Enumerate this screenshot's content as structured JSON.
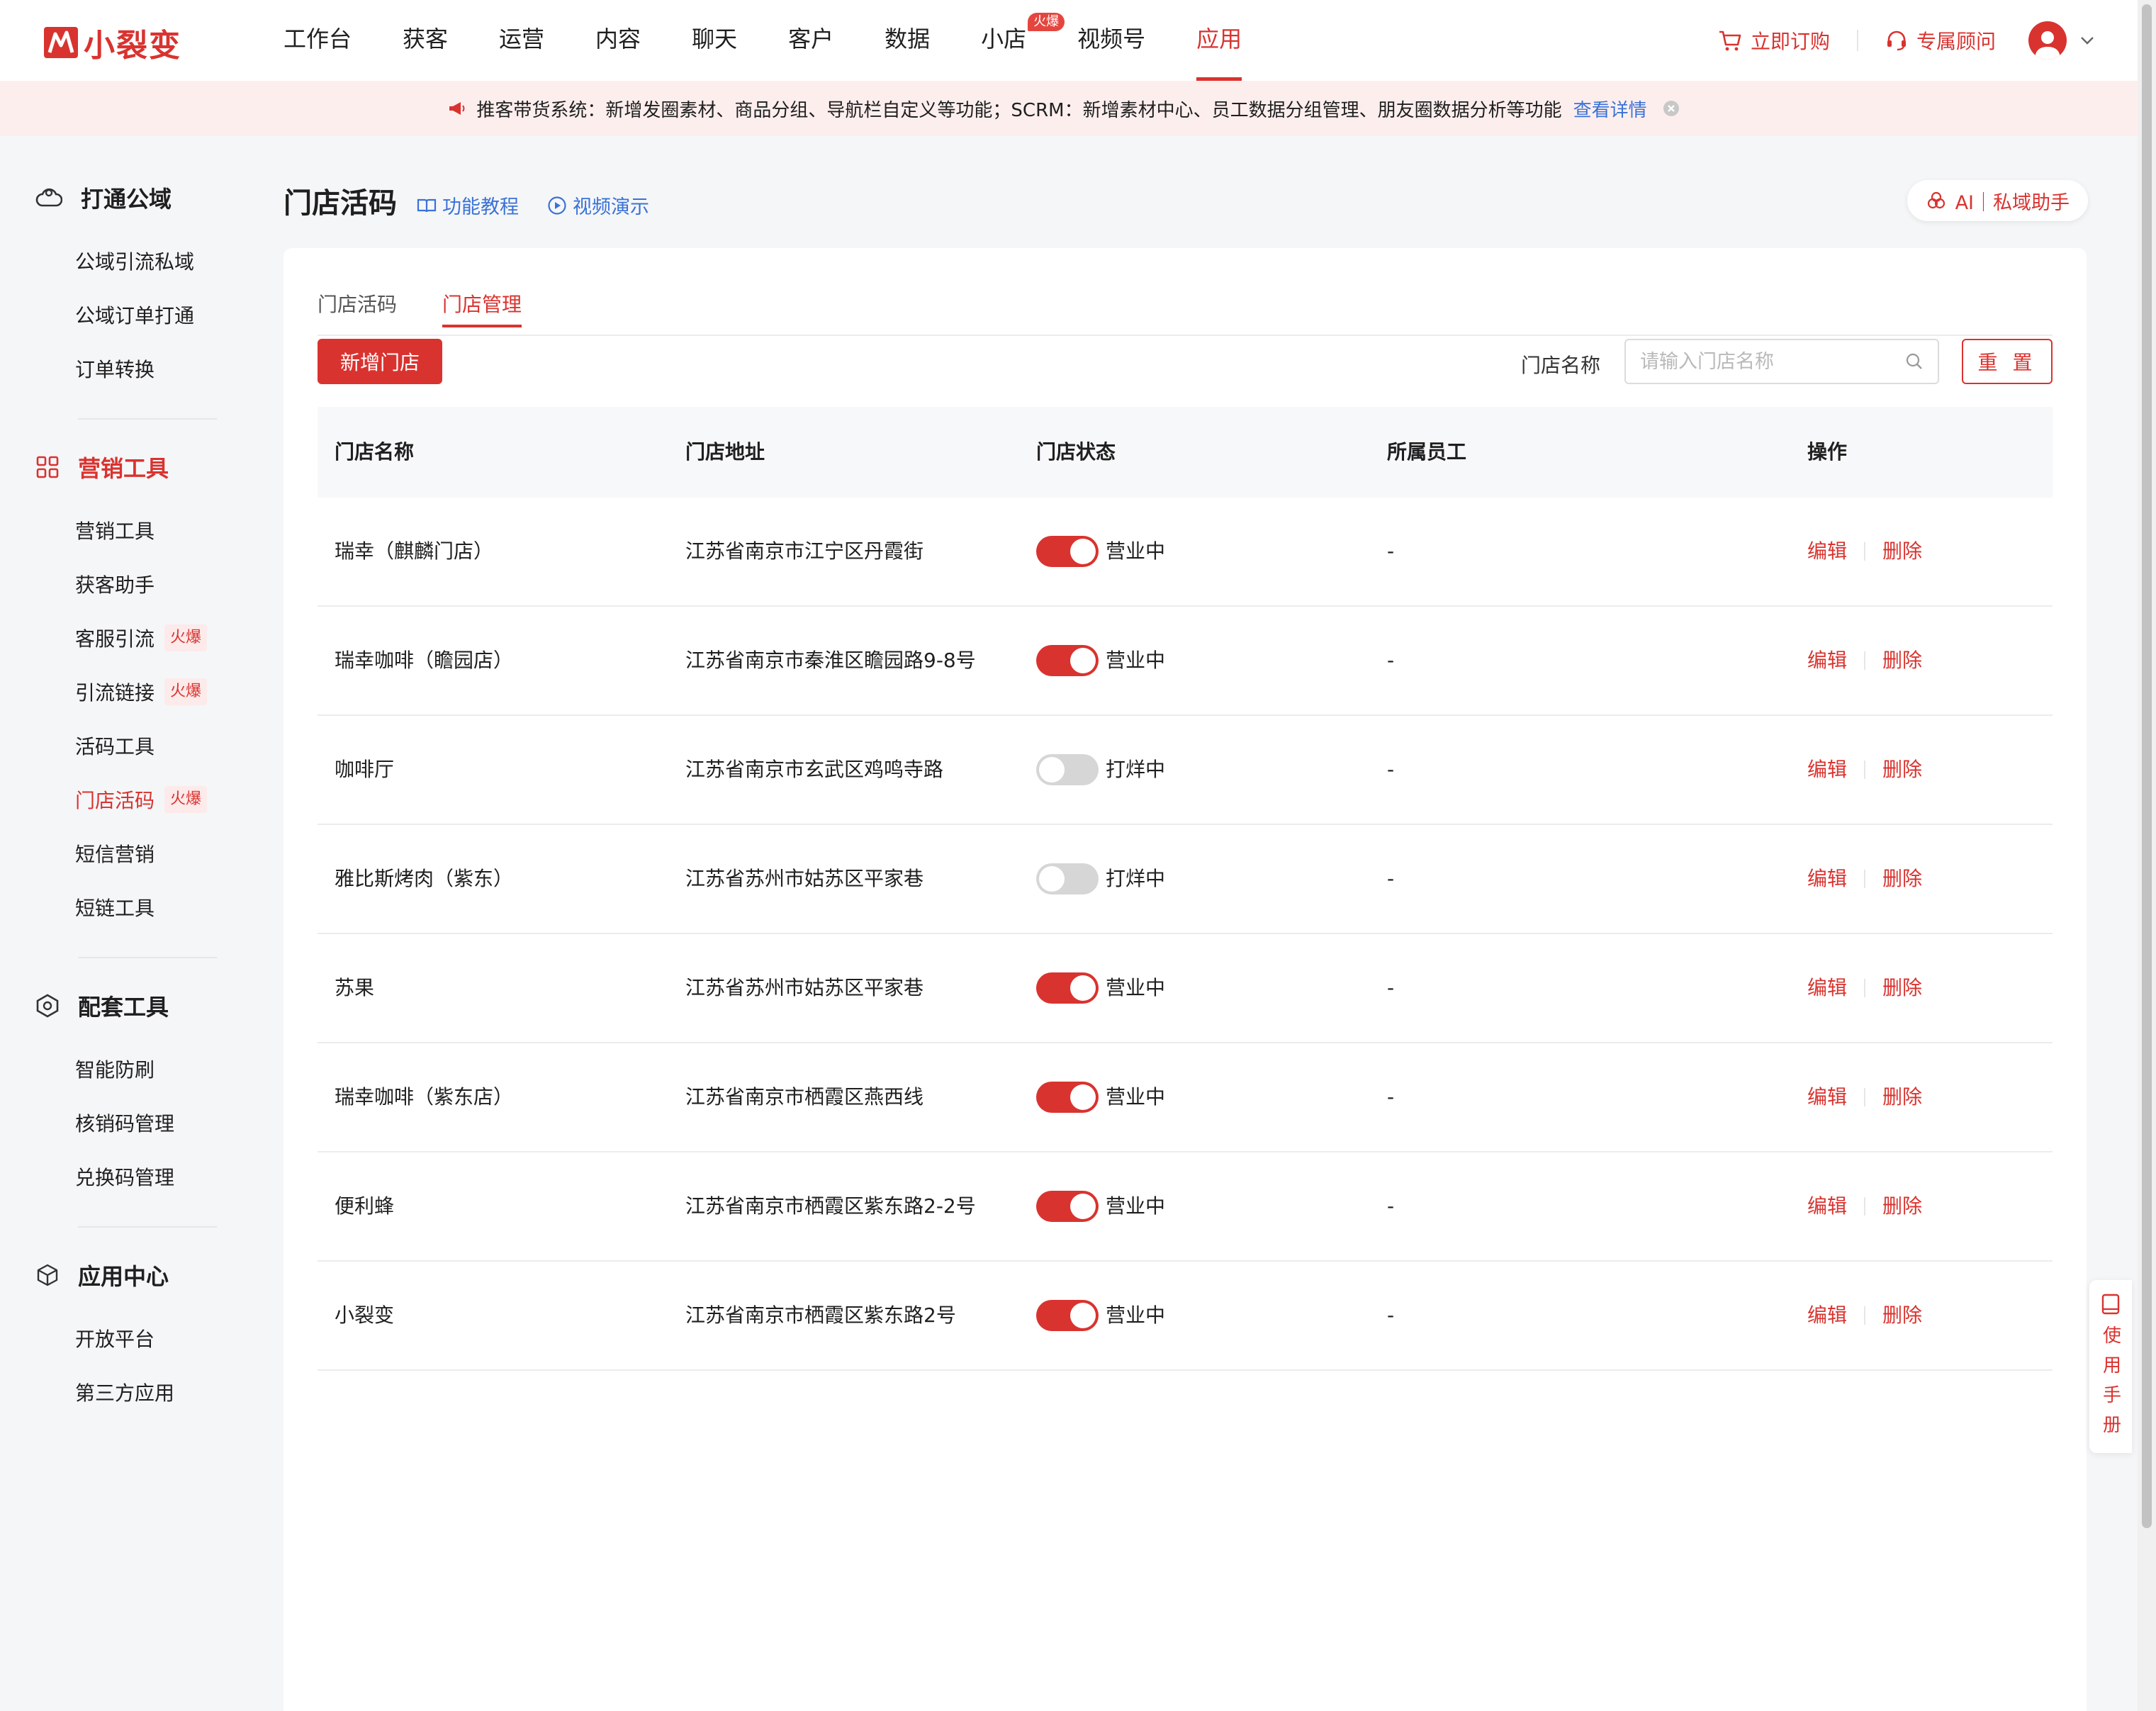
{
  "brand": {
    "name": "小裂变",
    "color": "#d9332f"
  },
  "nav": {
    "items": [
      {
        "label": "工作台"
      },
      {
        "label": "获客"
      },
      {
        "label": "运营"
      },
      {
        "label": "内容"
      },
      {
        "label": "聊天"
      },
      {
        "label": "客户"
      },
      {
        "label": "数据"
      },
      {
        "label": "小店",
        "badge": "火爆"
      },
      {
        "label": "视频号"
      },
      {
        "label": "应用",
        "active": true
      }
    ],
    "order_label": "立即订购",
    "consultant_label": "专属顾问"
  },
  "notice": {
    "text": "推客带货系统：新增发圈素材、商品分组、导航栏自定义等功能；SCRM：新增素材中心、员工数据分组管理、朋友圈数据分析等功能",
    "link": "查看详情"
  },
  "sidebar": {
    "groups": [
      {
        "title": "打通公域",
        "icon": "cloud-icon",
        "items": [
          "公域引流私域",
          "公域订单打通",
          "订单转换"
        ]
      },
      {
        "title": "营销工具",
        "icon": "grid-icon",
        "active": true,
        "items": [
          {
            "label": "营销工具"
          },
          {
            "label": "获客助手"
          },
          {
            "label": "客服引流",
            "badge": "火爆"
          },
          {
            "label": "引流链接",
            "badge": "火爆"
          },
          {
            "label": "活码工具"
          },
          {
            "label": "门店活码",
            "badge": "火爆",
            "active": true
          },
          {
            "label": "短信营销"
          },
          {
            "label": "短链工具"
          }
        ]
      },
      {
        "title": "配套工具",
        "icon": "hexagon-icon",
        "items": [
          "智能防刷",
          "核销码管理",
          "兑换码管理"
        ]
      },
      {
        "title": "应用中心",
        "icon": "cube-icon",
        "items": [
          "开放平台",
          "第三方应用"
        ]
      }
    ]
  },
  "page": {
    "title": "门店活码",
    "tutorial_link": "功能教程",
    "video_link": "视频演示",
    "ai_button": "AI｜私域助手"
  },
  "tabs": [
    {
      "label": "门店活码"
    },
    {
      "label": "门店管理",
      "active": true
    }
  ],
  "toolbar": {
    "add_label": "新增门店",
    "filter_label": "门店名称",
    "search_placeholder": "请输入门店名称",
    "search_value": "",
    "reset_label": "重 置"
  },
  "table": {
    "columns": [
      "门店名称",
      "门店地址",
      "门店状态",
      "所属员工",
      "操作"
    ],
    "rows": [
      {
        "name": "瑞幸（麒麟门店）",
        "address": "江苏省南京市江宁区丹霞街",
        "on": true,
        "status": "营业中",
        "staff": "-"
      },
      {
        "name": "瑞幸咖啡（瞻园店）",
        "address": "江苏省南京市秦淮区瞻园路9-8号",
        "on": true,
        "status": "营业中",
        "staff": "-"
      },
      {
        "name": "咖啡厅",
        "address": "江苏省南京市玄武区鸡鸣寺路",
        "on": false,
        "status": "打烊中",
        "staff": "-"
      },
      {
        "name": "雅比斯烤肉（紫东）",
        "address": "江苏省苏州市姑苏区平家巷",
        "on": false,
        "status": "打烊中",
        "staff": "-"
      },
      {
        "name": "苏果",
        "address": "江苏省苏州市姑苏区平家巷",
        "on": true,
        "status": "营业中",
        "staff": "-"
      },
      {
        "name": "瑞幸咖啡（紫东店）",
        "address": "江苏省南京市栖霞区燕西线",
        "on": true,
        "status": "营业中",
        "staff": "-"
      },
      {
        "name": "便利蜂",
        "address": "江苏省南京市栖霞区紫东路2-2号",
        "on": true,
        "status": "营业中",
        "staff": "-"
      },
      {
        "name": "小裂变",
        "address": "江苏省南京市栖霞区紫东路2号",
        "on": true,
        "status": "营业中",
        "staff": "-"
      }
    ],
    "edit_label": "编辑",
    "delete_label": "删除"
  },
  "manual": {
    "label": "使用手册"
  }
}
